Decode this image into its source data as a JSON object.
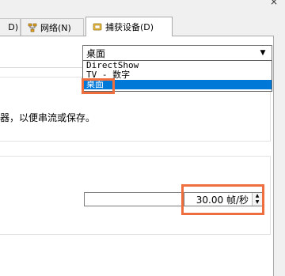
{
  "window": {
    "close_glyph": "×"
  },
  "tabs": [
    {
      "label": "D)"
    },
    {
      "label": "网络(N)",
      "icon": "network-icon"
    },
    {
      "label": "捕获设备(D)",
      "icon": "capture-device-icon",
      "active": true
    }
  ],
  "capture": {
    "device_select": {
      "selected": "桌面",
      "options": [
        "DirectShow",
        "TV - 数字",
        "桌面"
      ],
      "highlighted_option": "桌面"
    },
    "description": "器，以便串流或保存。",
    "frame_rate": {
      "value": "30.00 帧/秒"
    }
  },
  "colors": {
    "highlight_box": "#ee6e3f",
    "selection": "#0078d7"
  }
}
